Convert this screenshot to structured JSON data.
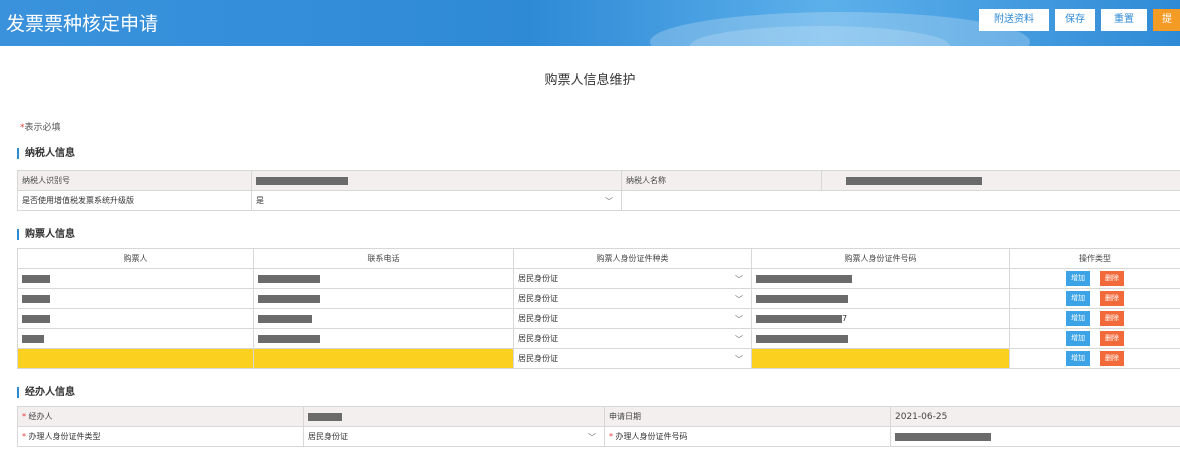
{
  "header": {
    "title": "发票票种核定申请",
    "buttons": {
      "attach": "附送资料",
      "save": "保存",
      "reset": "重置",
      "submit": "提交"
    }
  },
  "page_title": "购票人信息维护",
  "required_note": {
    "star": "*",
    "text": "表示必填"
  },
  "taxpayer_section": {
    "title": "纳税人信息",
    "id_label": "纳税人识别号",
    "id_value_masked": true,
    "name_label": "纳税人名称",
    "name_value_masked": true,
    "upgrade_label": "是否使用增值税发票系统升级版",
    "upgrade_value": "是"
  },
  "buyer_section": {
    "title": "购票人信息",
    "columns": [
      "购票人",
      "联系电话",
      "购票人身份证件种类",
      "购票人身份证件号码",
      "操作类型"
    ],
    "rows": [
      {
        "name_masked": true,
        "phone_masked": true,
        "id_type": "居民身份证",
        "id_tail": ""
      },
      {
        "name_masked": true,
        "phone_masked": true,
        "id_type": "居民身份证",
        "id_tail": ""
      },
      {
        "name_masked": true,
        "phone_masked": true,
        "id_type": "居民身份证",
        "id_tail": "7"
      },
      {
        "name_masked": true,
        "phone_masked": true,
        "id_type": "居民身份证",
        "id_tail": ""
      },
      {
        "name_masked": false,
        "phone_masked": false,
        "id_type": "居民身份证",
        "id_tail": ""
      }
    ],
    "add_label": "增加",
    "delete_label": "删除"
  },
  "agent_section": {
    "title": "经办人信息",
    "agent_label": "经办人",
    "date_label": "申请日期",
    "date_value": "2021-06-25",
    "id_type_label": "办理人身份证件类型",
    "id_type_value": "居民身份证",
    "id_no_label": "办理人身份证件号码"
  },
  "colors": {
    "brand_blue": "#2f8ad6",
    "required_red": "#e23b3b",
    "highlight_yellow": "#fcd01f",
    "add_blue": "#3ba3e6",
    "delete_orange": "#f26a3a",
    "submit_orange": "#f39b24"
  },
  "icons": {
    "select": "chevron-down-icon"
  }
}
